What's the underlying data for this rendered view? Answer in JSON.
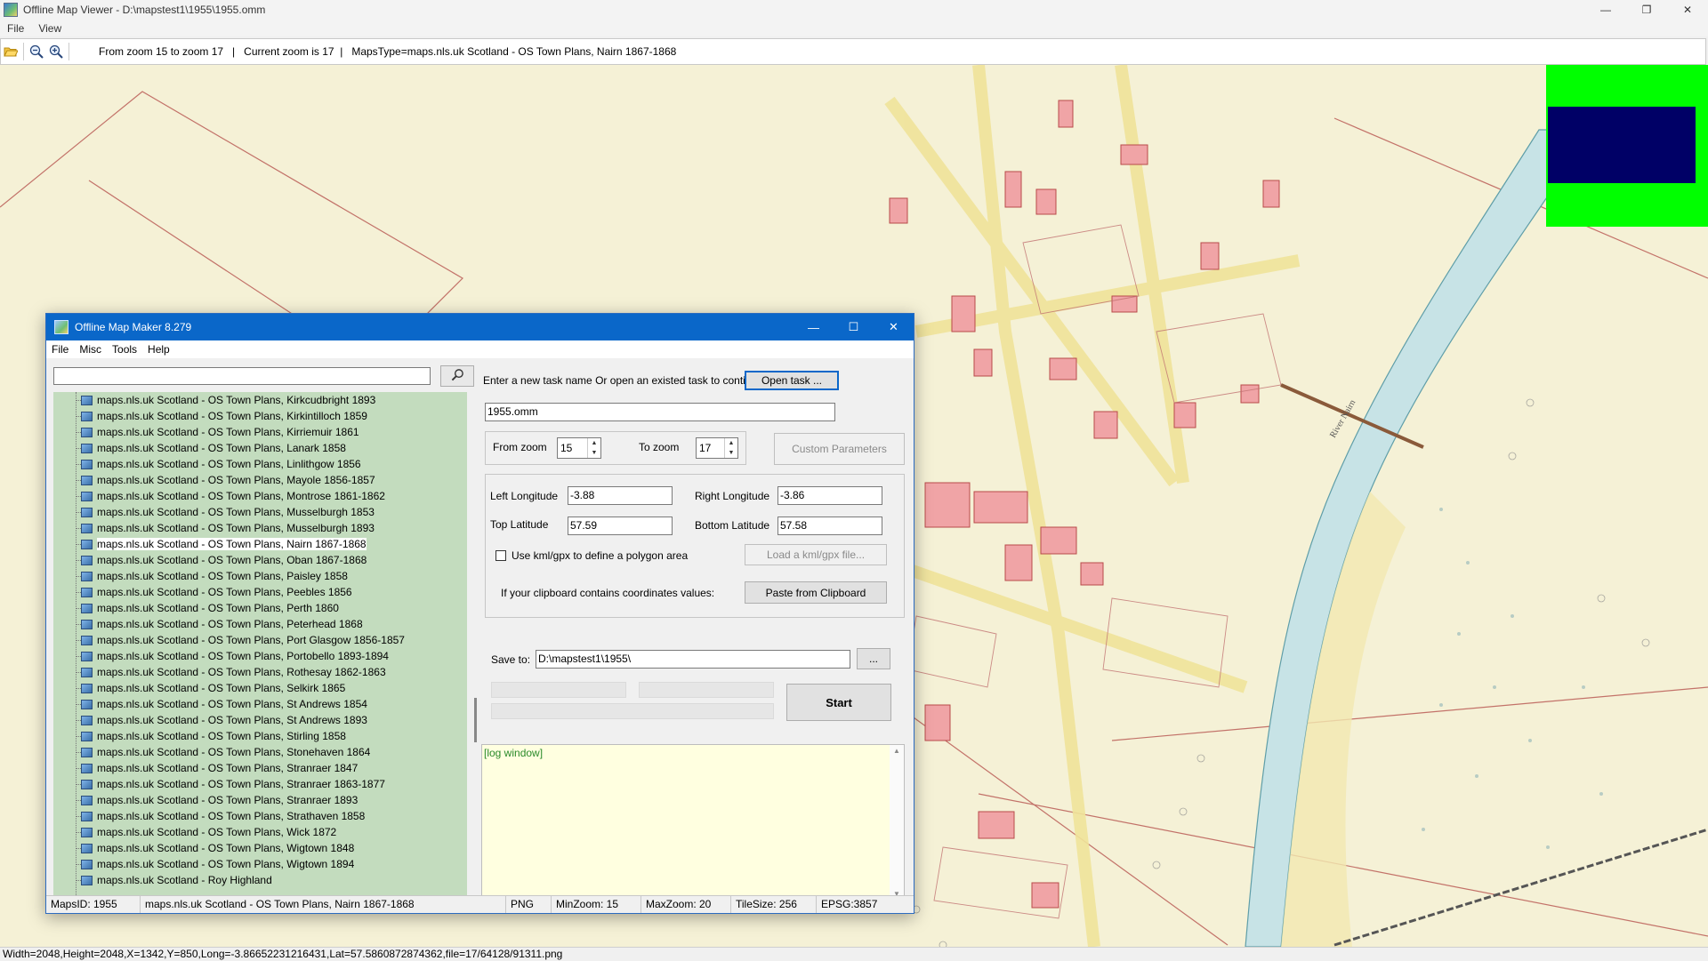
{
  "window": {
    "title": "Offline Map Viewer - D:\\mapstest1\\1955\\1955.omm",
    "controls": {
      "minimize": "—",
      "maximize": "❐",
      "close": "✕"
    }
  },
  "menu": [
    "File",
    "View"
  ],
  "toolbar": {
    "open_icon": "folder-open-icon",
    "zoom_out_icon": "zoom-out-icon",
    "zoom_in_icon": "zoom-in-icon",
    "info": "From zoom 15 to zoom 17   |   Current zoom is 17  |   MapsType=maps.nls.uk Scotland - OS Town Plans, Nairn 1867-1868"
  },
  "statusbar": "Width=2048,Height=2048,X=1342,Y=850,Long=-3.86652231216431,Lat=57.5860872874362,file=17/64128/91311.png",
  "map": {
    "river_label": "River Nairn"
  },
  "dialog": {
    "title": "Offline Map Maker 8.279",
    "controls": {
      "minimize": "—",
      "maximize": "☐",
      "close": "✕"
    },
    "menu": [
      "File",
      "Misc",
      "Tools",
      "Help"
    ],
    "search": {
      "value": "",
      "button_icon": "search-icon"
    },
    "tree_items": [
      "maps.nls.uk Scotland - OS Town Plans, Kirkcudbright 1893",
      "maps.nls.uk Scotland - OS Town Plans, Kirkintilloch 1859",
      "maps.nls.uk Scotland - OS Town Plans, Kirriemuir 1861",
      "maps.nls.uk Scotland - OS Town Plans, Lanark 1858",
      "maps.nls.uk Scotland - OS Town Plans, Linlithgow 1856",
      "maps.nls.uk Scotland - OS Town Plans, Mayole 1856-1857",
      "maps.nls.uk Scotland - OS Town Plans, Montrose 1861-1862",
      "maps.nls.uk Scotland - OS Town Plans, Musselburgh 1853",
      "maps.nls.uk Scotland - OS Town Plans, Musselburgh 1893",
      "maps.nls.uk Scotland - OS Town Plans, Nairn 1867-1868",
      "maps.nls.uk Scotland - OS Town Plans, Oban 1867-1868",
      "maps.nls.uk Scotland - OS Town Plans, Paisley 1858",
      "maps.nls.uk Scotland - OS Town Plans, Peebles 1856",
      "maps.nls.uk Scotland - OS Town Plans, Perth 1860",
      "maps.nls.uk Scotland - OS Town Plans, Peterhead 1868",
      "maps.nls.uk Scotland - OS Town Plans, Port Glasgow 1856-1857",
      "maps.nls.uk Scotland - OS Town Plans, Portobello 1893-1894",
      "maps.nls.uk Scotland - OS Town Plans, Rothesay 1862-1863",
      "maps.nls.uk Scotland - OS Town Plans, Selkirk 1865",
      "maps.nls.uk Scotland - OS Town Plans, St Andrews 1854",
      "maps.nls.uk Scotland - OS Town Plans, St Andrews 1893",
      "maps.nls.uk Scotland - OS Town Plans, Stirling 1858",
      "maps.nls.uk Scotland - OS Town Plans, Stonehaven 1864",
      "maps.nls.uk Scotland - OS Town Plans, Stranraer 1847",
      "maps.nls.uk Scotland - OS Town Plans, Stranraer 1863-1877",
      "maps.nls.uk Scotland - OS Town Plans, Stranraer 1893",
      "maps.nls.uk Scotland - OS Town Plans, Strathaven 1858",
      "maps.nls.uk Scotland - OS Town Plans, Wick 1872",
      "maps.nls.uk Scotland - OS Town Plans, Wigtown 1848",
      "maps.nls.uk Scotland - OS Town Plans, Wigtown 1894",
      "maps.nls.uk Scotland - Roy Highland"
    ],
    "selected_item": "maps.nls.uk Scotland - OS Town Plans, Nairn 1867-1868",
    "task_prompt": "Enter a new task name Or open an existed task to continue:",
    "open_task_label": "Open task ...",
    "task_name": "1955.omm",
    "from_zoom_label": "From zoom",
    "from_zoom": "15",
    "to_zoom_label": "To zoom",
    "to_zoom": "17",
    "custom_params_label": "Custom Parameters",
    "left_lon_label": "Left Longitude",
    "left_lon": "-3.88",
    "right_lon_label": "Right Longitude",
    "right_lon": "-3.86",
    "top_lat_label": "Top Latitude",
    "top_lat": "57.59",
    "bottom_lat_label": "Bottom Latitude",
    "bottom_lat": "57.58",
    "kml_label": "Use kml/gpx to define a polygon area",
    "load_kml_label": "Load a kml/gpx file...",
    "clipboard_prompt": "If your clipboard contains coordinates values:",
    "paste_label": "Paste from Clipboard",
    "save_to_label": "Save to:",
    "save_path": "D:\\mapstest1\\1955\\",
    "browse_label": "...",
    "start_label": "Start",
    "log_text": "[log window]",
    "status": {
      "maps_id": "MapsID: 1955",
      "maps_name": "maps.nls.uk Scotland - OS Town Plans, Nairn 1867-1868",
      "format": "PNG",
      "min_zoom": "MinZoom: 15",
      "max_zoom": "MaxZoom: 20",
      "tile_size": "TileSize: 256",
      "epsg": "EPSG:3857"
    }
  }
}
